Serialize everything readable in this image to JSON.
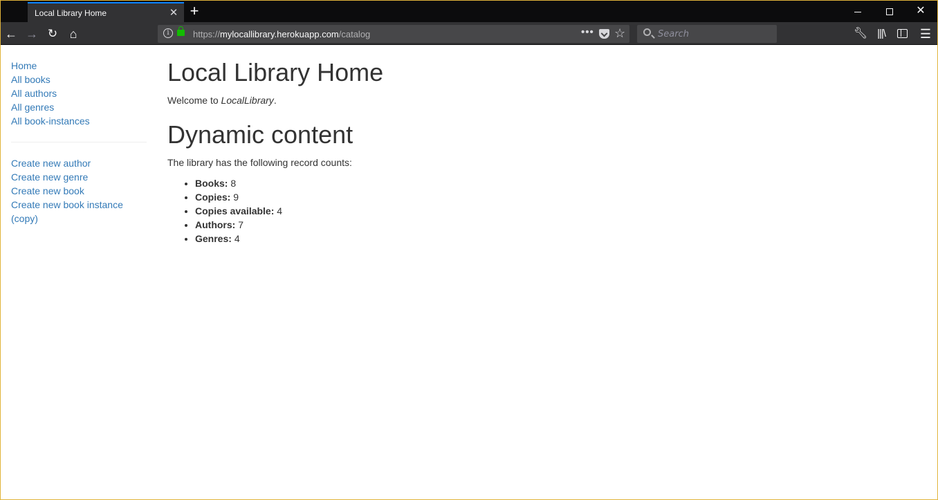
{
  "browser": {
    "tab_title": "Local Library Home",
    "url_scheme": "https://",
    "url_host": "mylocallibrary.herokuapp.com",
    "url_path": "/catalog",
    "search_placeholder": "Search",
    "accent_color": "#0a84ff"
  },
  "sidebar": {
    "primary_links": [
      "Home",
      "All books",
      "All authors",
      "All genres",
      "All book-instances"
    ],
    "create_links": [
      "Create new author",
      "Create new genre",
      "Create new book",
      "Create new book instance (copy)"
    ]
  },
  "main": {
    "title": "Local Library Home",
    "welcome_prefix": "Welcome to ",
    "welcome_name": "LocalLibrary",
    "welcome_suffix": ".",
    "section_title": "Dynamic content",
    "intro": "The library has the following record counts:",
    "counts": [
      {
        "label": "Books:",
        "value": "8"
      },
      {
        "label": "Copies:",
        "value": "9"
      },
      {
        "label": "Copies available:",
        "value": "4"
      },
      {
        "label": "Authors:",
        "value": "7"
      },
      {
        "label": "Genres:",
        "value": "4"
      }
    ]
  },
  "colors": {
    "link": "#337ab7",
    "text": "#333333"
  }
}
